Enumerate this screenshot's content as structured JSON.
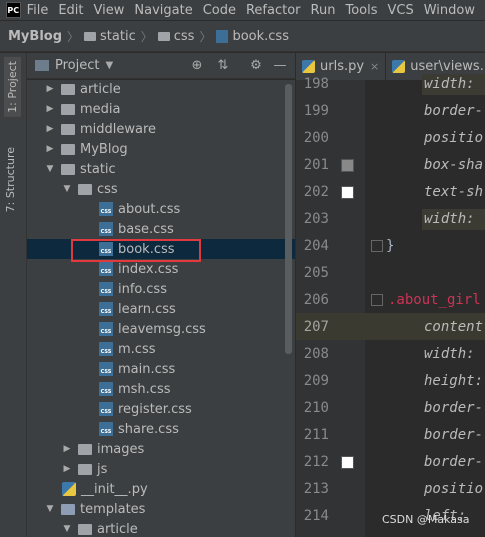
{
  "menubar": {
    "logo": "PC",
    "items": [
      "File",
      "Edit",
      "View",
      "Navigate",
      "Code",
      "Refactor",
      "Run",
      "Tools",
      "VCS",
      "Window"
    ]
  },
  "breadcrumb": {
    "project": "MyBlog",
    "items": [
      "static",
      "css",
      "book.css"
    ]
  },
  "side_stripe": {
    "project_tab": "1: Project",
    "structure_tab": "7: Structure"
  },
  "project_panel": {
    "title": "Project",
    "dropdown_icon": "chevron-down-icon",
    "tools": [
      "globe-icon",
      "collapse-icon",
      "gear-icon",
      "minimize-icon"
    ]
  },
  "tree": [
    {
      "label": "article",
      "type": "folder",
      "expanded": false,
      "depth": 1
    },
    {
      "label": "media",
      "type": "folder",
      "expanded": false,
      "depth": 1
    },
    {
      "label": "middleware",
      "type": "folder",
      "expanded": false,
      "depth": 1
    },
    {
      "label": "MyBlog",
      "type": "folder",
      "expanded": false,
      "depth": 1
    },
    {
      "label": "static",
      "type": "folder",
      "expanded": true,
      "depth": 1
    },
    {
      "label": "css",
      "type": "folder",
      "expanded": true,
      "depth": 2
    },
    {
      "label": "about.css",
      "type": "css",
      "depth": 3
    },
    {
      "label": "base.css",
      "type": "css",
      "depth": 3
    },
    {
      "label": "book.css",
      "type": "css",
      "depth": 3,
      "selected": true
    },
    {
      "label": "index.css",
      "type": "css",
      "depth": 3
    },
    {
      "label": "info.css",
      "type": "css",
      "depth": 3
    },
    {
      "label": "learn.css",
      "type": "css",
      "depth": 3
    },
    {
      "label": "leavemsg.css",
      "type": "css",
      "depth": 3
    },
    {
      "label": "m.css",
      "type": "css",
      "depth": 3
    },
    {
      "label": "main.css",
      "type": "css",
      "depth": 3
    },
    {
      "label": "msh.css",
      "type": "css",
      "depth": 3
    },
    {
      "label": "register.css",
      "type": "css",
      "depth": 3
    },
    {
      "label": "share.css",
      "type": "css",
      "depth": 3
    },
    {
      "label": "images",
      "type": "folder",
      "expanded": false,
      "depth": 2
    },
    {
      "label": "js",
      "type": "folder",
      "expanded": false,
      "depth": 2
    },
    {
      "label": "__init__.py",
      "type": "py",
      "depth": 2
    },
    {
      "label": "templates",
      "type": "template",
      "expanded": true,
      "depth": 1
    },
    {
      "label": "article",
      "type": "folder",
      "expanded": true,
      "depth": 2
    }
  ],
  "tabs": [
    {
      "label": "urls.py",
      "close": "×"
    },
    {
      "label": "user\\views.py",
      "close": ""
    }
  ],
  "editor": {
    "lines": [
      {
        "no": "198",
        "code": "width:",
        "kind": "prop"
      },
      {
        "no": "199",
        "code": "border-",
        "kind": "prop"
      },
      {
        "no": "200",
        "code": "positio",
        "kind": "prop"
      },
      {
        "no": "201",
        "code": "box-sha",
        "kind": "prop",
        "swatch": "#888888"
      },
      {
        "no": "202",
        "code": "text-sh",
        "kind": "prop",
        "swatch": "#ffffff"
      },
      {
        "no": "203",
        "code": "width:",
        "kind": "prop"
      },
      {
        "no": "204",
        "code": "}",
        "kind": "brace"
      },
      {
        "no": "205",
        "code": "",
        "kind": "blank"
      },
      {
        "no": "206",
        "code": ".about_girl",
        "kind": "selector"
      },
      {
        "no": "207",
        "code": "content",
        "kind": "prop",
        "current": true
      },
      {
        "no": "208",
        "code": "width:",
        "kind": "prop"
      },
      {
        "no": "209",
        "code": "height:",
        "kind": "prop"
      },
      {
        "no": "210",
        "code": "border-",
        "kind": "prop"
      },
      {
        "no": "211",
        "code": "border-",
        "kind": "prop"
      },
      {
        "no": "212",
        "code": "border-",
        "kind": "prop",
        "swatch": "#ffffff"
      },
      {
        "no": "213",
        "code": "positio",
        "kind": "prop"
      },
      {
        "no": "214",
        "code": "left:",
        "kind": "prop"
      }
    ]
  },
  "watermark": "CSDN @Makasa"
}
